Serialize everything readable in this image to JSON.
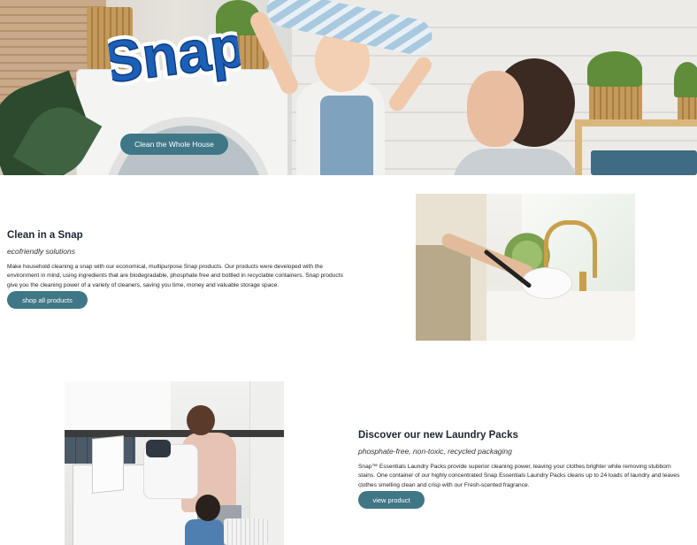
{
  "hero": {
    "logo_text": "Snap",
    "button_label": "Clean the Whole House"
  },
  "section1": {
    "title": "Clean in a Snap",
    "subtitle": "ecofriendly solutions",
    "body": "Make household cleaning a snap with our economical, multipurpose Snap products. Our products were developed with the environment in mind, using ingredients that are biodegradable, phosphate free and bottled in recyclable containers. Snap products give you the cleaning power of a variety of cleaners, saving you time, money and valuable storage space.",
    "button_label": "shop all products"
  },
  "section2": {
    "title": "Discover our new Laundry Packs",
    "subtitle": "phosphate-free, non-toxic, recycled packaging",
    "body": "Snap™ Essentials Laundry Packs provide superior cleaning power, leaving your clothes brighter while removing stubborn stains. One container of our highly concentrated Snap Essentials Laundry Packs cleans up to 24 loads of laundry and leaves clothes smelling clean and crisp with our Fresh-scented fragrance.",
    "button_label": "view product"
  },
  "colors": {
    "accent": "#3f7787",
    "logo_blue": "#1c5fb8",
    "heading": "#1e2630"
  }
}
